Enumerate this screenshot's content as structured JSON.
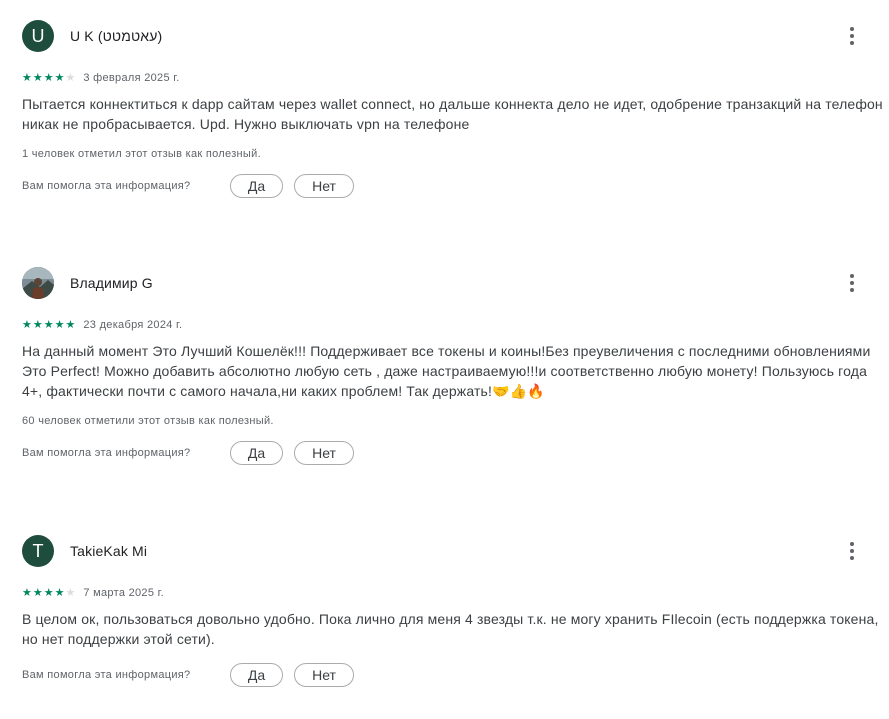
{
  "reviews": [
    {
      "author": "U K (עאטמטט)",
      "avatar_letter": "U",
      "rating": 4,
      "date": "3 февраля 2025 г.",
      "text": "Пытается коннектиться к dapp сайтам через wallet connect, но дальше коннекта дело не идет, одобрение транзакций на телефон никак не пробрасывается. Upd. Нужно выключать vpn на телефоне",
      "helpful": "1 человек отметил этот отзыв как полезный.",
      "question": "Вам помогла эта информация?",
      "yes": "Да",
      "no": "Нет"
    },
    {
      "author": "Владимир G",
      "avatar_letter": "",
      "rating": 5,
      "date": "23 декабря 2024 г.",
      "text": "На данный момент Это Лучший Кошелёк!!! Поддерживает все токены и коины!Без преувеличения с последними обновлениями Это Perfect! Можно добавить абсолютно любую сеть , даже настраиваемую!!!и соответственно любую монету! Пользуюсь года 4+, фактически почти с самого начала,ни каких проблем! Так держать!🤝👍🔥",
      "helpful": "60 человек отметили этот отзыв как полезный.",
      "question": "Вам помогла эта информация?",
      "yes": "Да",
      "no": "Нет"
    },
    {
      "author": "TakieKak Mi",
      "avatar_letter": "T",
      "rating": 4,
      "date": "7 марта 2025 г.",
      "text": "В целом ок, пользоваться довольно удобно. Пока лично для меня 4 звезды т.к. не могу хранить FIlecoin (есть поддержка токена, но нет поддержки этой сети).",
      "question": "Вам помогла эта информация?",
      "yes": "Да",
      "no": "Нет"
    }
  ],
  "colors": {
    "avatar": "#1e4d3e",
    "star_filled": "#01875f",
    "star_empty": "#dadce0",
    "text_secondary": "#5f6368"
  },
  "icons": {
    "menu": "more-vert-icon",
    "star": "star-icon"
  }
}
